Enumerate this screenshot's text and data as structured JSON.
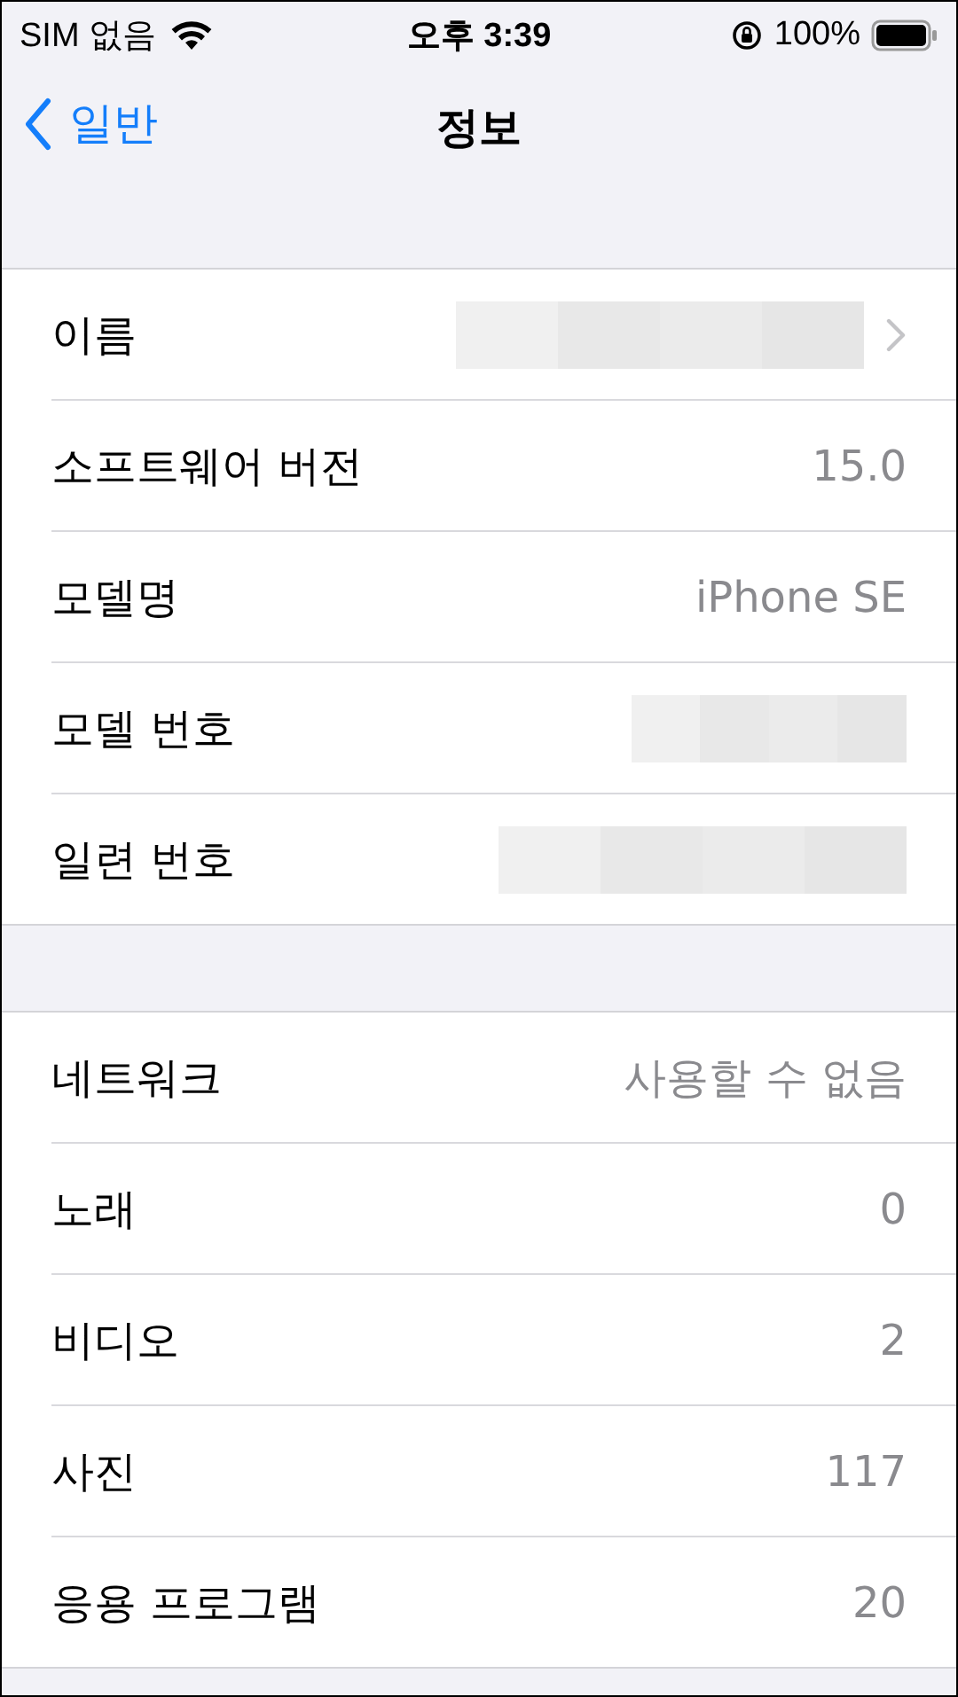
{
  "status_bar": {
    "carrier": "SIM 없음",
    "time": "오후 3:39",
    "battery": "100%"
  },
  "nav": {
    "back": "일반",
    "title": "정보"
  },
  "groups": [
    {
      "rows": [
        {
          "label": "이름",
          "kind": "redacted",
          "chevron": true
        },
        {
          "label": "소프트웨어 버전",
          "kind": "value",
          "value": "15.0",
          "chevron": false
        },
        {
          "label": "모델명",
          "kind": "value",
          "value": "iPhone SE",
          "chevron": false
        },
        {
          "label": "모델 번호",
          "kind": "redacted",
          "chevron": false
        },
        {
          "label": "일련 번호",
          "kind": "redacted",
          "chevron": false
        }
      ]
    },
    {
      "rows": [
        {
          "label": "네트워크",
          "kind": "value",
          "value": "사용할 수 없음",
          "chevron": false
        },
        {
          "label": "노래",
          "kind": "value",
          "value": "0",
          "chevron": false
        },
        {
          "label": "비디오",
          "kind": "value",
          "value": "2",
          "chevron": false
        },
        {
          "label": "사진",
          "kind": "value",
          "value": "117",
          "chevron": false
        },
        {
          "label": "응용 프로그램",
          "kind": "value",
          "value": "20",
          "chevron": false
        }
      ]
    }
  ]
}
